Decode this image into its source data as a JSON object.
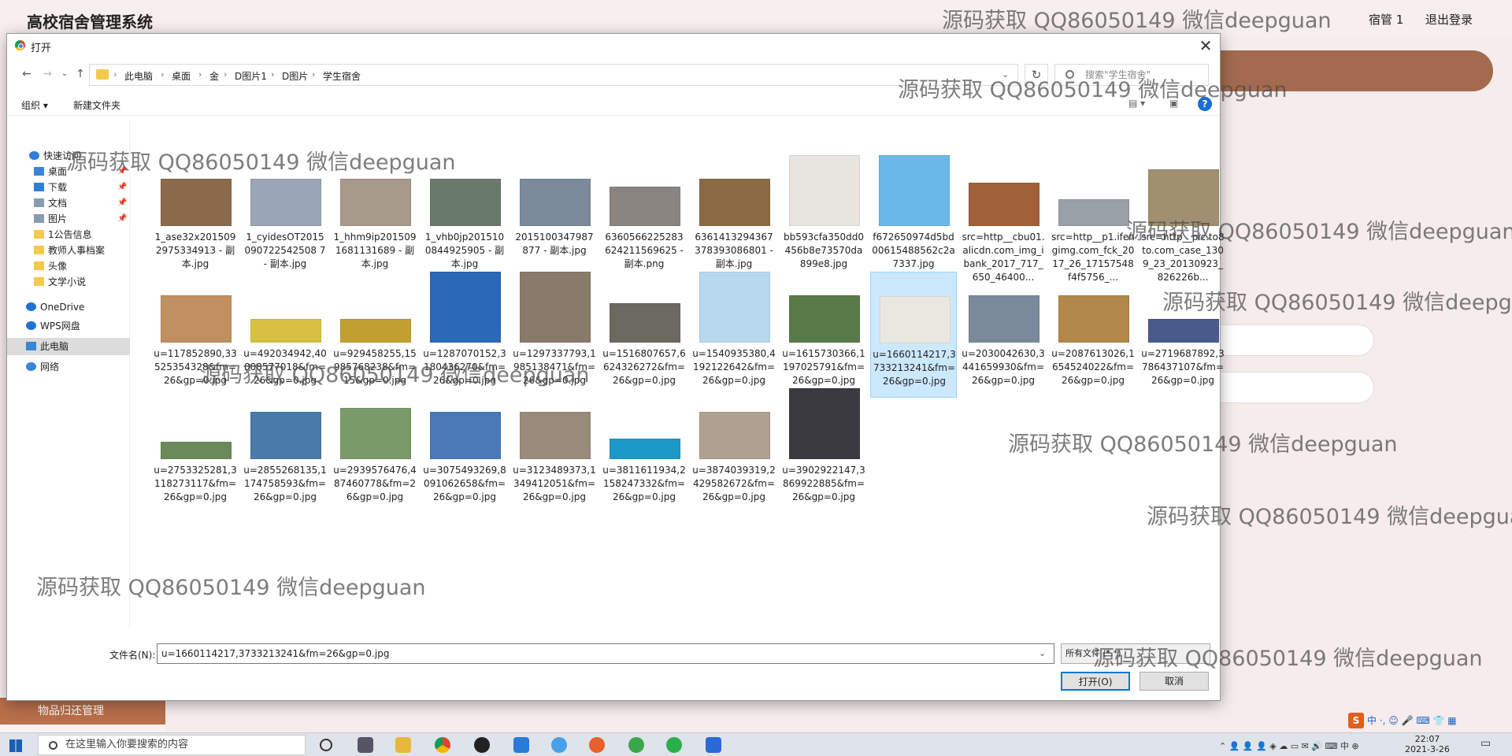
{
  "app": {
    "title": "高校宿舍管理系统",
    "user": "宿管 1",
    "logout": "退出登录",
    "sidebar_item": "物品归还管理"
  },
  "watermark": "源码获取 QQ86050149 微信deepguan",
  "dialog": {
    "title": "打开",
    "breadcrumb": [
      "此电脑",
      "桌面",
      "金",
      "D图片1",
      "D图片",
      "学生宿舍"
    ],
    "search_placeholder": "搜索\"学生宿舍\"",
    "toolbar": {
      "organize": "组织 ▾",
      "new_folder": "新建文件夹"
    },
    "nav": [
      {
        "label": "快速访问",
        "icon": "star-icon",
        "color": "#2f7fd8"
      },
      {
        "label": "桌面",
        "icon": "desktop-icon",
        "color": "#3a86d6",
        "pinned": true
      },
      {
        "label": "下载",
        "icon": "download-icon",
        "color": "#2f7fd8",
        "pinned": true
      },
      {
        "label": "文档",
        "icon": "document-icon",
        "color": "#8a9bb0",
        "pinned": true
      },
      {
        "label": "图片",
        "icon": "pictures-icon",
        "color": "#8a9bb0",
        "pinned": true
      },
      {
        "label": "1公告信息",
        "icon": "folder-icon",
        "color": "#f5c94b"
      },
      {
        "label": "教师人事档案",
        "icon": "folder-icon",
        "color": "#f5c94b"
      },
      {
        "label": "头像",
        "icon": "folder-icon",
        "color": "#f5c94b"
      },
      {
        "label": "文学小说",
        "icon": "folder-icon",
        "color": "#f5c94b"
      },
      {
        "label": "OneDrive",
        "icon": "cloud-icon",
        "color": "#1a74d8"
      },
      {
        "label": "WPS网盘",
        "icon": "cloud-icon",
        "color": "#1a74d8"
      },
      {
        "label": "此电脑",
        "icon": "computer-icon",
        "color": "#3a86d6",
        "selected": true
      },
      {
        "label": "网络",
        "icon": "network-icon",
        "color": "#3a86d6"
      }
    ],
    "files": [
      {
        "name": "1_ase32x2015092975334913 - 副本.jpg",
        "color": "#8a6a4a"
      },
      {
        "name": "1_cyidesOT2015090722542508 7 - 副本.jpg",
        "color": "#9aa5b5"
      },
      {
        "name": "1_hhm9ip2015091681131689 - 副本.jpg",
        "color": "#a89a8a"
      },
      {
        "name": "1_vhb0jp2015100844925905 - 副本.jpg",
        "color": "#6a7a6a"
      },
      {
        "name": "2015100347987877 - 副本.jpg",
        "color": "#7a8a9a"
      },
      {
        "name": "6360566225283624211569625 - 副本.png",
        "color": "#8a8580"
      },
      {
        "name": "6361413294367378393086801 - 副本.jpg",
        "color": "#8a6a45"
      },
      {
        "name": "bb593cfa350dd0456b8e73570da899e8.jpg",
        "color": "#e8e4e0"
      },
      {
        "name": "f672650974d5bd00615488562c2a7337.jpg",
        "color": "#6ab8e8"
      },
      {
        "name": "src=http__cbu01.alicdn.com_img_ibank_2017_717_650_46400...",
        "color": "#a0603a"
      },
      {
        "name": "src=http__p1.ifengimg.com_fck_2017_26_17157548f4f5756_...",
        "color": "#9aa0a8"
      },
      {
        "name": "src=http__pic.to8to.com_case_1309_23_20130923_826226b...",
        "color": "#a09070"
      },
      {
        "name": "u=117852890,33525354328&fm=26&gp=0.jpg",
        "color": "#c09060"
      },
      {
        "name": "u=492034942,40008577018&fm=26&gp=0.jpg",
        "color": "#d8c040"
      },
      {
        "name": "u=929458255,15985768238&fm=15&gp=0.jpg",
        "color": "#c0a030"
      },
      {
        "name": "u=1287070152,3180436270&fm=26&gp=0.jpg",
        "color": "#2a68b8"
      },
      {
        "name": "u=1297337793,1985138471&fm=26&gp=0.jpg",
        "color": "#8a7a6a"
      },
      {
        "name": "u=1516807657,6624326272&fm=26&gp=0.jpg",
        "color": "#6a6a60"
      },
      {
        "name": "u=1540935380,4192122642&fm=26&gp=0.jpg",
        "color": "#b8d8f0"
      },
      {
        "name": "u=1615730366,1197025791&fm=26&gp=0.jpg",
        "color": "#5a7a4a"
      },
      {
        "name": "u=1660114217,3733213241&fm=26&gp=0.jpg",
        "color": "#e8e8e0",
        "selected": true
      },
      {
        "name": "u=2030042630,3441659930&fm=26&gp=0.jpg",
        "color": "#7a8a9a"
      },
      {
        "name": "u=2087613026,1654524022&fm=26&gp=0.jpg",
        "color": "#b0884a"
      },
      {
        "name": "u=2719687892,3786437107&fm=26&gp=0.jpg",
        "color": "#4a5a8a"
      },
      {
        "name": "u=2753325281,3118273117&fm=26&gp=0.jpg",
        "color": "#6a8a5a"
      },
      {
        "name": "u=2855268135,1174758593&fm=26&gp=0.jpg",
        "color": "#4a7aa8"
      },
      {
        "name": "u=2939576476,487460778&fm=26&gp=0.jpg",
        "color": "#7a9a6a"
      },
      {
        "name": "u=3075493269,8091062658&fm=26&gp=0.jpg",
        "color": "#4a7ab8"
      },
      {
        "name": "u=3123489373,1349412051&fm=26&gp=0.jpg",
        "color": "#9a8a7a"
      },
      {
        "name": "u=3811611934,2158247332&fm=26&gp=0.jpg",
        "color": "#1a9ac8"
      },
      {
        "name": "u=3874039319,2429582672&fm=26&gp=0.jpg",
        "color": "#b0a090"
      },
      {
        "name": "u=3902922147,3869922885&fm=26&gp=0.jpg",
        "color": "#3a3a40"
      }
    ],
    "filename_label": "文件名(N):",
    "filename_value": "u=1660114217,3733213241&fm=26&gp=0.jpg",
    "filetype": "所有文件 (*.*)",
    "open_btn": "打开(O)",
    "cancel_btn": "取消"
  },
  "taskbar": {
    "search_placeholder": "在这里输入你要搜索的内容",
    "time": "22:07",
    "date": "2021-3-26",
    "ime": "中"
  }
}
